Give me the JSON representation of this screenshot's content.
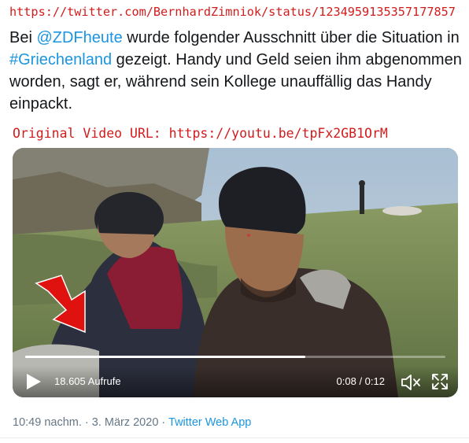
{
  "source_url": "https://twitter.com/BernhardZimniok/status/1234959135357177857",
  "tweet": {
    "part1": "Bei ",
    "mention": "@ZDFheute",
    "part2": " wurde folgender Ausschnitt über die Situation in ",
    "hashtag": "#Griechenland",
    "part3": " gezeigt. Handy und Geld seien ihm abgenommen worden, sagt er, während sein Kollege unauffällig das Handy einpackt."
  },
  "original_video_label": "Original Video URL: https://youtu.be/tpFx2GB1OrM",
  "video": {
    "views": "18.605 Aufrufe",
    "time": "0:08 / 0:12",
    "progress": 0.667,
    "annotation_color": "#e0120f"
  },
  "meta": {
    "timestamp": "10:49 nachm. · 3. März 2020 · ",
    "app": "Twitter Web App"
  },
  "icons": [
    "play-icon",
    "volume-icon",
    "fullscreen-icon",
    "red-arrow-annotation"
  ]
}
